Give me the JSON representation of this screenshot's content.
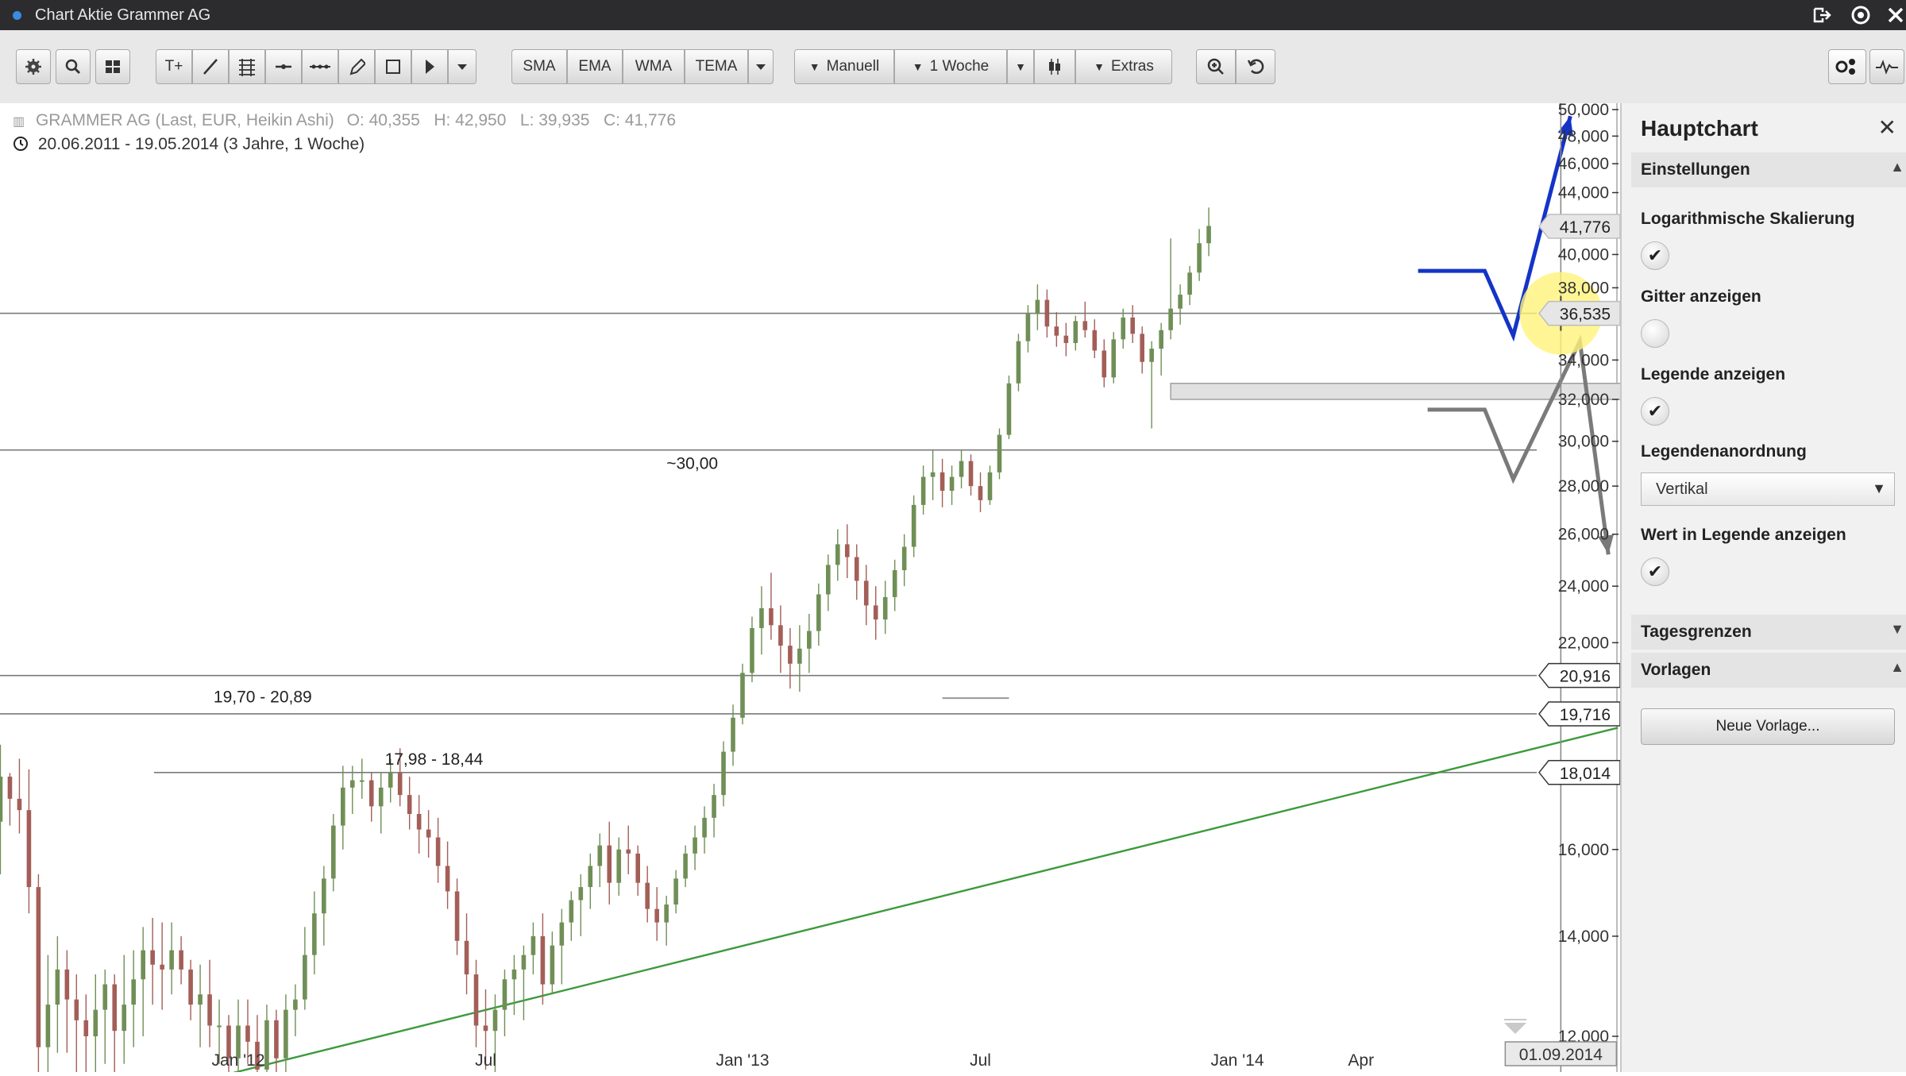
{
  "window": {
    "title": "Chart Aktie Grammer AG",
    "icons": [
      "exit-icon",
      "settings-icon",
      "close-icon"
    ]
  },
  "toolbar": {
    "indicator_buttons": [
      "SMA",
      "EMA",
      "WMA",
      "TEMA"
    ],
    "manual_label": "Manuell",
    "interval_label": "1 Woche",
    "extras_label": "Extras"
  },
  "legend": {
    "instrument": "GRAMMER AG (Last, EUR, Heikin Ashi)",
    "ohlc": "O: 40,355   H: 42,950   L: 39,935   C: 41,776",
    "period": "20.06.2011 - 19.05.2014 (3 Jahre, 1 Woche)"
  },
  "chart_data": {
    "type": "candlestick",
    "scale": "logarithmic",
    "grid": false,
    "y_ticks": [
      "50,000",
      "48,000",
      "46,000",
      "44,000",
      "40,000",
      "38,000",
      "34,000",
      "32,000",
      "30,000",
      "28,000",
      "26,000",
      "24,000",
      "22,000",
      "16,000",
      "14,000",
      "12,000"
    ],
    "x_ticks": [
      "Jan '12",
      "Jul",
      "Jan '13",
      "Jul",
      "Jan '14",
      "Apr"
    ],
    "price_tags": [
      "41,776",
      "36,535",
      "20,916",
      "19,716",
      "18,014"
    ],
    "zone_labels": [
      "~30,00",
      "19,70 - 20,89",
      "17,98 - 18,44"
    ],
    "crosshair_date": "01.09.2014",
    "candles_weekly": [
      [
        13.6,
        15.6,
        12.5,
        14.5
      ],
      [
        14.5,
        16.4,
        13.7,
        15.7
      ],
      [
        15.7,
        18.3,
        15.0,
        16.7
      ],
      [
        16.7,
        18.8,
        15.4,
        17.9
      ],
      [
        17.9,
        18.0,
        16.6,
        17.3
      ],
      [
        17.3,
        18.4,
        16.4,
        17.0
      ],
      [
        17.0,
        18.1,
        14.5,
        15.1
      ],
      [
        15.1,
        15.4,
        11.3,
        11.8
      ],
      [
        11.8,
        13.6,
        11.0,
        12.6
      ],
      [
        12.6,
        14.0,
        11.7,
        13.3
      ],
      [
        13.3,
        13.7,
        11.7,
        12.7
      ],
      [
        12.7,
        13.2,
        11.0,
        12.3
      ],
      [
        12.3,
        12.8,
        10.9,
        12.0
      ],
      [
        12.0,
        13.2,
        10.4,
        12.5
      ],
      [
        12.5,
        13.3,
        11.5,
        13.0
      ],
      [
        13.0,
        13.2,
        11.2,
        12.1
      ],
      [
        12.1,
        13.6,
        11.5,
        12.6
      ],
      [
        12.6,
        13.7,
        11.8,
        13.1
      ],
      [
        13.1,
        14.2,
        12.0,
        13.7
      ],
      [
        13.7,
        14.4,
        12.6,
        13.4
      ],
      [
        13.4,
        14.3,
        12.5,
        13.3
      ],
      [
        13.3,
        14.3,
        12.8,
        13.7
      ],
      [
        13.7,
        14.0,
        13.0,
        13.3
      ],
      [
        13.3,
        13.5,
        12.3,
        12.6
      ],
      [
        12.6,
        13.4,
        11.8,
        12.8
      ],
      [
        12.8,
        13.5,
        11.8,
        12.2
      ],
      [
        12.2,
        12.7,
        11.5,
        12.2
      ],
      [
        12.2,
        12.4,
        10.9,
        11.6
      ],
      [
        11.6,
        12.7,
        11.0,
        12.2
      ],
      [
        12.2,
        12.7,
        11.5,
        11.9
      ],
      [
        11.9,
        12.4,
        11.0,
        11.4
      ],
      [
        11.4,
        12.6,
        11.1,
        12.3
      ],
      [
        12.3,
        12.5,
        11.3,
        11.6
      ],
      [
        11.6,
        12.8,
        11.3,
        12.5
      ],
      [
        12.5,
        13.0,
        12.0,
        12.7
      ],
      [
        12.7,
        14.2,
        12.5,
        13.6
      ],
      [
        13.6,
        15.0,
        13.2,
        14.5
      ],
      [
        14.5,
        15.6,
        13.8,
        15.3
      ],
      [
        15.3,
        16.9,
        15.0,
        16.6
      ],
      [
        16.6,
        18.2,
        16.0,
        17.6
      ],
      [
        17.6,
        18.2,
        16.9,
        17.8
      ],
      [
        17.8,
        18.4,
        17.3,
        17.8
      ],
      [
        17.8,
        18.0,
        16.7,
        17.1
      ],
      [
        17.1,
        18.0,
        16.4,
        17.6
      ],
      [
        17.6,
        18.4,
        17.2,
        18.0
      ],
      [
        18.0,
        18.7,
        17.1,
        17.4
      ],
      [
        17.4,
        17.9,
        16.5,
        16.9
      ],
      [
        16.9,
        17.4,
        15.9,
        16.5
      ],
      [
        16.5,
        17.0,
        15.8,
        16.3
      ],
      [
        16.3,
        16.8,
        15.2,
        15.6
      ],
      [
        15.6,
        16.2,
        14.6,
        15.0
      ],
      [
        15.0,
        15.3,
        13.6,
        13.9
      ],
      [
        13.9,
        14.5,
        12.8,
        13.2
      ],
      [
        13.2,
        13.5,
        11.8,
        12.2
      ],
      [
        12.2,
        12.9,
        11.4,
        12.1
      ],
      [
        12.1,
        12.8,
        11.1,
        12.5
      ],
      [
        12.5,
        13.3,
        12.0,
        13.1
      ],
      [
        13.1,
        13.6,
        12.4,
        13.3
      ],
      [
        13.3,
        13.8,
        12.3,
        13.6
      ],
      [
        13.6,
        14.3,
        13.2,
        14.0
      ],
      [
        14.0,
        14.5,
        12.6,
        13.0
      ],
      [
        13.0,
        14.1,
        12.8,
        13.8
      ],
      [
        13.8,
        14.6,
        13.0,
        14.3
      ],
      [
        14.3,
        15.0,
        13.9,
        14.8
      ],
      [
        14.8,
        15.4,
        14.0,
        15.1
      ],
      [
        15.1,
        15.9,
        14.6,
        15.6
      ],
      [
        15.6,
        16.4,
        15.1,
        16.1
      ],
      [
        16.1,
        16.7,
        14.7,
        15.2
      ],
      [
        15.2,
        16.3,
        14.9,
        16.0
      ],
      [
        16.0,
        16.6,
        15.4,
        15.9
      ],
      [
        15.9,
        16.1,
        14.9,
        15.2
      ],
      [
        15.2,
        15.6,
        14.3,
        14.6
      ],
      [
        14.6,
        15.1,
        13.9,
        14.3
      ],
      [
        14.3,
        14.9,
        13.8,
        14.7
      ],
      [
        14.7,
        15.5,
        14.5,
        15.3
      ],
      [
        15.3,
        16.1,
        15.1,
        15.9
      ],
      [
        15.9,
        16.6,
        15.5,
        16.3
      ],
      [
        16.3,
        17.1,
        15.9,
        16.8
      ],
      [
        16.8,
        17.7,
        16.3,
        17.4
      ],
      [
        17.4,
        18.9,
        17.1,
        18.6
      ],
      [
        18.6,
        20.0,
        18.2,
        19.6
      ],
      [
        19.6,
        21.3,
        19.4,
        21.0
      ],
      [
        21.0,
        22.9,
        20.7,
        22.5
      ],
      [
        22.5,
        24.0,
        21.6,
        23.2
      ],
      [
        23.2,
        24.5,
        22.1,
        22.6
      ],
      [
        22.6,
        23.3,
        21.0,
        21.9
      ],
      [
        21.9,
        22.5,
        20.5,
        21.3
      ],
      [
        21.3,
        22.6,
        20.4,
        21.8
      ],
      [
        21.8,
        23.0,
        21.0,
        22.4
      ],
      [
        22.4,
        24.1,
        21.9,
        23.7
      ],
      [
        23.7,
        25.2,
        23.1,
        24.8
      ],
      [
        24.8,
        26.2,
        24.2,
        25.6
      ],
      [
        25.6,
        26.4,
        24.3,
        25.1
      ],
      [
        25.1,
        25.6,
        23.5,
        24.2
      ],
      [
        24.2,
        24.8,
        22.6,
        23.3
      ],
      [
        23.3,
        24.0,
        22.1,
        22.8
      ],
      [
        22.8,
        24.2,
        22.3,
        23.6
      ],
      [
        23.6,
        25.0,
        23.1,
        24.6
      ],
      [
        24.6,
        26.0,
        24.0,
        25.5
      ],
      [
        25.5,
        27.6,
        25.1,
        27.2
      ],
      [
        27.2,
        28.9,
        26.8,
        28.4
      ],
      [
        28.4,
        29.6,
        27.4,
        28.6
      ],
      [
        28.6,
        29.2,
        27.1,
        27.8
      ],
      [
        27.8,
        28.9,
        27.2,
        28.4
      ],
      [
        28.4,
        29.6,
        27.9,
        29.1
      ],
      [
        29.1,
        29.4,
        27.6,
        28.0
      ],
      [
        28.0,
        28.6,
        26.9,
        27.4
      ],
      [
        27.4,
        28.9,
        27.2,
        28.6
      ],
      [
        28.6,
        30.6,
        28.3,
        30.3
      ],
      [
        30.3,
        33.2,
        30.1,
        32.8
      ],
      [
        32.8,
        35.4,
        32.4,
        35.0
      ],
      [
        35.0,
        37.0,
        34.4,
        36.5
      ],
      [
        36.5,
        38.2,
        35.6,
        37.3
      ],
      [
        37.3,
        37.9,
        35.2,
        35.8
      ],
      [
        35.8,
        36.6,
        34.7,
        35.3
      ],
      [
        35.3,
        36.0,
        34.2,
        34.9
      ],
      [
        34.9,
        36.4,
        34.5,
        36.1
      ],
      [
        36.1,
        37.2,
        35.2,
        35.6
      ],
      [
        35.6,
        36.2,
        34.1,
        34.5
      ],
      [
        34.5,
        35.1,
        32.6,
        33.1
      ],
      [
        33.1,
        35.5,
        32.8,
        35.1
      ],
      [
        35.1,
        36.8,
        34.6,
        36.3
      ],
      [
        36.3,
        37.0,
        34.9,
        35.4
      ],
      [
        35.4,
        35.8,
        33.3,
        33.9
      ],
      [
        33.9,
        35.0,
        30.6,
        34.6
      ],
      [
        34.6,
        36.0,
        33.2,
        35.6
      ],
      [
        35.6,
        41.0,
        35.1,
        36.8
      ],
      [
        36.8,
        38.2,
        35.9,
        37.6
      ],
      [
        37.6,
        39.3,
        37.0,
        38.9
      ],
      [
        38.9,
        41.6,
        38.4,
        40.7
      ],
      [
        40.7,
        43.0,
        39.9,
        41.8
      ]
    ],
    "forecast_scenarios": [
      {
        "name": "up",
        "color": "#1434c8",
        "points": [
          [
            "19.05.2014",
            39.0
          ],
          [
            "07.07.2014",
            39.0
          ],
          [
            "28.07.2014",
            35.3
          ],
          [
            "08.09.2014",
            49.5
          ]
        ]
      },
      {
        "name": "down",
        "color": "#7a7a7a",
        "points": [
          [
            "26.05.2014",
            31.5
          ],
          [
            "07.07.2014",
            31.5
          ],
          [
            "28.07.2014",
            28.3
          ],
          [
            "15.09.2014",
            35.0
          ],
          [
            "06.10.2014",
            25.2
          ]
        ]
      }
    ],
    "support_band": [
      32.0,
      32.8
    ],
    "levels": [
      36.535,
      29.6,
      20.916,
      19.716,
      18.014
    ],
    "trendline": [
      [
        "05.12.2011",
        11.2
      ],
      [
        "13.10.2014",
        19.3
      ]
    ]
  },
  "panel": {
    "title": "Hauptchart",
    "sections": {
      "settings": "Einstellungen",
      "day_limits": "Tagesgrenzen",
      "templates": "Vorlagen"
    },
    "options": {
      "log_scale": "Logarithmische Skalierung",
      "grid": "Gitter anzeigen",
      "legend": "Legende anzeigen",
      "legend_layout": "Legendenanordnung",
      "legend_value": "Wert in Legende anzeigen"
    },
    "checks": {
      "log_scale": true,
      "grid": false,
      "legend": true,
      "legend_value": true
    },
    "legend_layout_value": "Vertikal",
    "new_template_button": "Neue Vorlage..."
  }
}
